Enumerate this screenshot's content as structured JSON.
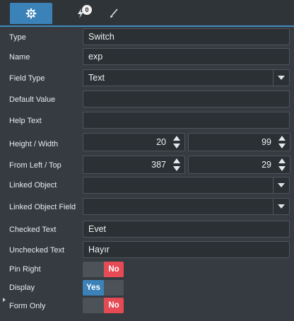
{
  "tabs": {
    "events_badge": "0"
  },
  "form": {
    "type": {
      "label": "Type",
      "value": "Switch"
    },
    "name": {
      "label": "Name",
      "value": "exp"
    },
    "field_type": {
      "label": "Field Type",
      "value": "Text"
    },
    "default_value": {
      "label": "Default Value",
      "value": ""
    },
    "help_text": {
      "label": "Help Text",
      "value": ""
    },
    "height_width": {
      "label": "Height / Width",
      "height": "20",
      "width": "99"
    },
    "from_left_top": {
      "label": "From Left / Top",
      "left": "387",
      "top": "29"
    },
    "linked_object": {
      "label": "Linked Object",
      "value": ""
    },
    "linked_object_field": {
      "label": "Linked Object Field",
      "value": ""
    },
    "checked_text": {
      "label": "Checked Text",
      "value": "Evet"
    },
    "unchecked_text": {
      "label": "Unchecked Text",
      "value": "Hayır"
    },
    "pin_right": {
      "label": "Pin Right",
      "state": "No"
    },
    "display": {
      "label": "Display",
      "state": "Yes"
    },
    "form_only": {
      "label": "Form Only",
      "state": "No"
    }
  }
}
